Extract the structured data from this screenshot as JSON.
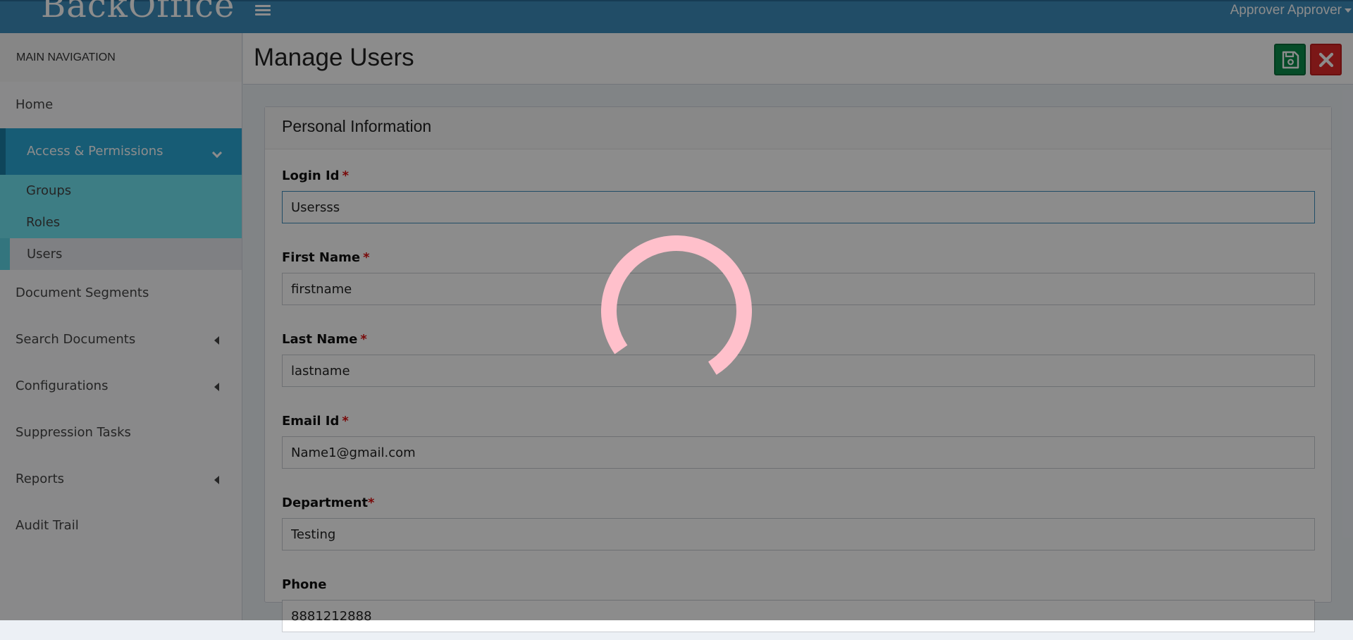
{
  "header": {
    "brand": "BackOffice",
    "user_menu": "Approver Approver"
  },
  "sidebar": {
    "nav_header": "MAIN NAVIGATION",
    "items": [
      {
        "label": "Home"
      },
      {
        "label": "Access & Permissions"
      },
      {
        "label": "Document Segments"
      },
      {
        "label": "Search Documents"
      },
      {
        "label": "Configurations"
      },
      {
        "label": "Suppression Tasks"
      },
      {
        "label": "Reports"
      },
      {
        "label": "Audit Trail"
      }
    ],
    "sub_items": [
      {
        "label": "Groups"
      },
      {
        "label": "Roles"
      },
      {
        "label": "Users"
      }
    ]
  },
  "page": {
    "title": "Manage Users"
  },
  "form": {
    "section_title": "Personal Information",
    "required_marker": "*",
    "fields": [
      {
        "label": "Login Id",
        "value": "Usersss"
      },
      {
        "label": "First Name",
        "value": "firstname"
      },
      {
        "label": "Last Name",
        "value": "lastname"
      },
      {
        "label": "Email Id",
        "value": "Name1@gmail.com"
      },
      {
        "label": "Department",
        "value": "Testing"
      },
      {
        "label": "Phone",
        "value": "8881212888"
      }
    ]
  },
  "colors": {
    "header": "#3c8dbc",
    "active_nav": "#2aa8d6",
    "save_button": "#0a8a4a",
    "close_button": "#e02b2b",
    "spinner": "#ffc0cb"
  }
}
